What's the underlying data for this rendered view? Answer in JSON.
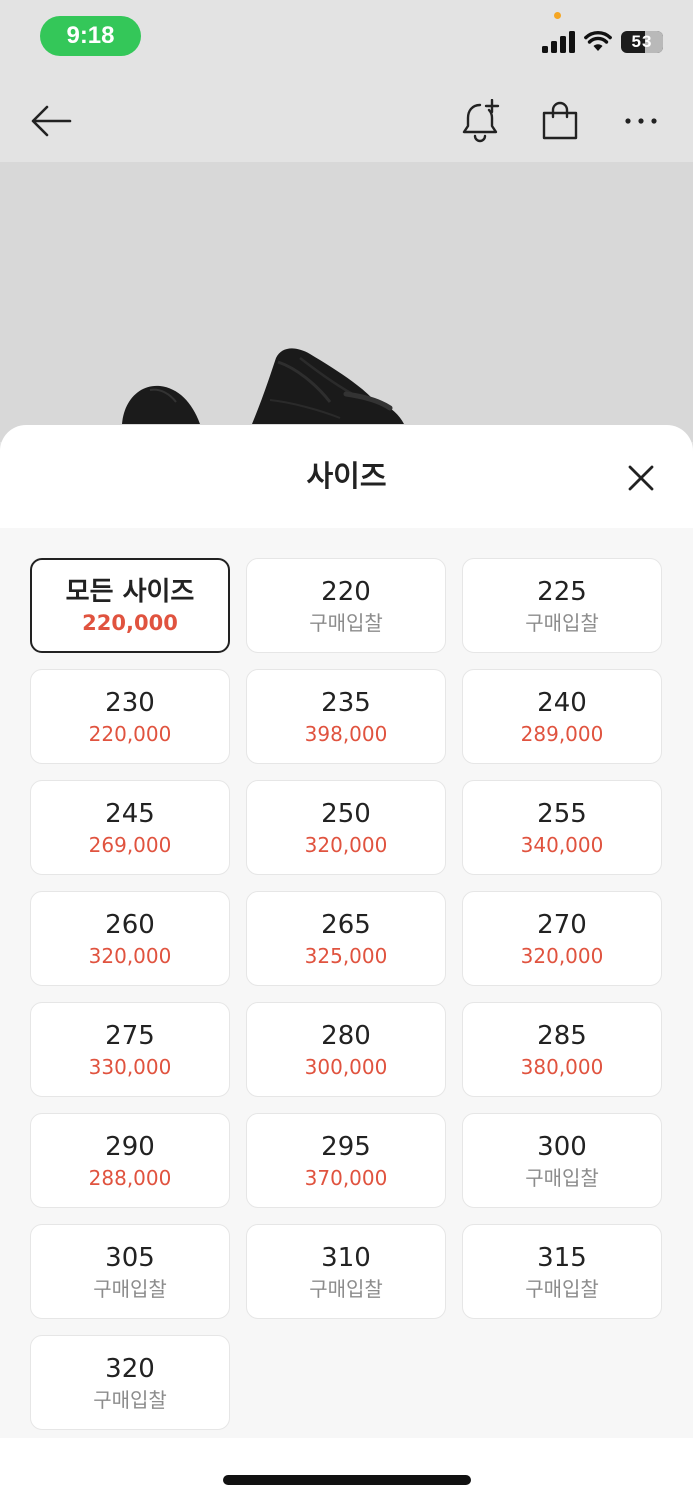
{
  "status_bar": {
    "time": "9:18",
    "battery": "53",
    "icons": [
      "signal-icon",
      "wifi-icon",
      "battery-icon"
    ]
  },
  "header": {
    "icons": [
      "back-arrow-icon",
      "bell-plus-icon",
      "shopping-bag-icon",
      "more-icon"
    ]
  },
  "sheet": {
    "title": "사이즈",
    "close_icon": "close-icon",
    "sizes": [
      {
        "label": "모든 사이즈",
        "price": "220,000",
        "selected": true,
        "bid": false
      },
      {
        "label": "220",
        "price": "구매입찰",
        "bid": true
      },
      {
        "label": "225",
        "price": "구매입찰",
        "bid": true
      },
      {
        "label": "230",
        "price": "220,000",
        "bid": false
      },
      {
        "label": "235",
        "price": "398,000",
        "bid": false
      },
      {
        "label": "240",
        "price": "289,000",
        "bid": false
      },
      {
        "label": "245",
        "price": "269,000",
        "bid": false
      },
      {
        "label": "250",
        "price": "320,000",
        "bid": false
      },
      {
        "label": "255",
        "price": "340,000",
        "bid": false
      },
      {
        "label": "260",
        "price": "320,000",
        "bid": false
      },
      {
        "label": "265",
        "price": "325,000",
        "bid": false
      },
      {
        "label": "270",
        "price": "320,000",
        "bid": false
      },
      {
        "label": "275",
        "price": "330,000",
        "bid": false
      },
      {
        "label": "280",
        "price": "300,000",
        "bid": false
      },
      {
        "label": "285",
        "price": "380,000",
        "bid": false
      },
      {
        "label": "290",
        "price": "288,000",
        "bid": false
      },
      {
        "label": "295",
        "price": "370,000",
        "bid": false
      },
      {
        "label": "300",
        "price": "구매입찰",
        "bid": true
      },
      {
        "label": "305",
        "price": "구매입찰",
        "bid": true
      },
      {
        "label": "310",
        "price": "구매입찰",
        "bid": true
      },
      {
        "label": "315",
        "price": "구매입찰",
        "bid": true
      },
      {
        "label": "320",
        "price": "구매입찰",
        "bid": true
      }
    ]
  },
  "colors": {
    "price_red": "#e0533f",
    "bid_gray": "#8c8c8c",
    "status_green": "#34c759"
  }
}
